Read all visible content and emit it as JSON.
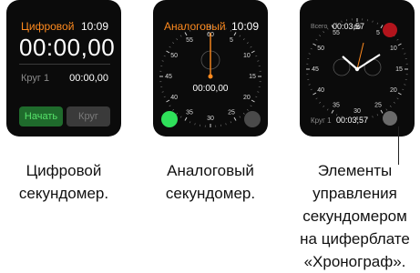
{
  "digital": {
    "mode_label": "Цифровой",
    "clock": "10:09",
    "elapsed": "00:00,00",
    "lap_label": "Круг 1",
    "lap_time": "00:00,00",
    "start_button": "Начать",
    "lap_button": "Круг"
  },
  "analog": {
    "mode_label": "Аналоговый",
    "clock": "10:09",
    "elapsed": "00:00,00",
    "dial_numbers": [
      "60",
      "5",
      "10",
      "15",
      "20",
      "25",
      "30",
      "35",
      "40",
      "45",
      "50",
      "55"
    ]
  },
  "chrono": {
    "total_label": "Всего",
    "total_time": "00:03,57",
    "lap_label": "Круг 1",
    "lap_time": "00:03,57",
    "dial_numbers": [
      "60",
      "5",
      "10",
      "15",
      "20",
      "25",
      "30",
      "35",
      "40",
      "45",
      "50",
      "55"
    ]
  },
  "captions": {
    "digital_line1": "Цифровой",
    "digital_line2": "секундомер.",
    "analog_line1": "Аналоговый",
    "analog_line2": "секундомер.",
    "chrono_line1": "Элементы",
    "chrono_line2": "управления",
    "chrono_line3": "секундомером",
    "chrono_line4": "на циферблате",
    "chrono_line5": "«Хронограф»."
  },
  "colors": {
    "accent": "#ff8a1e",
    "start_green": "#1f6b2c",
    "red_button": "#b3141c",
    "gray_button": "#4a4a4a"
  }
}
